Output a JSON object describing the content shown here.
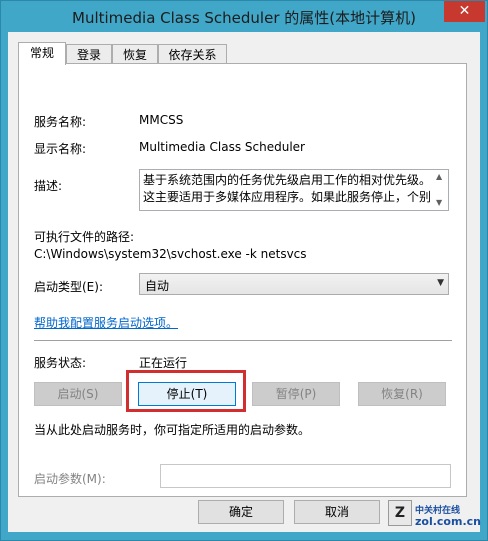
{
  "window": {
    "title": "Multimedia Class Scheduler 的属性(本地计算机)",
    "close_symbol": "✕"
  },
  "tabs": [
    {
      "label": "常规",
      "active": true
    },
    {
      "label": "登录",
      "active": false
    },
    {
      "label": "恢复",
      "active": false
    },
    {
      "label": "依存关系",
      "active": false
    }
  ],
  "general": {
    "service_name_label": "服务名称:",
    "service_name": "MMCSS",
    "display_name_label": "显示名称:",
    "display_name": "Multimedia Class Scheduler",
    "description_label": "描述:",
    "description": "基于系统范围内的任务优先级启用工作的相对优先级。这主要适用于多媒体应用程序。如果此服务停止，个别",
    "exe_path_label": "可执行文件的路径:",
    "exe_path": "C:\\Windows\\system32\\svchost.exe -k netsvcs",
    "startup_type_label": "启动类型(E):",
    "startup_type": "自动",
    "help_link": "帮助我配置服务启动选项。",
    "status_label": "服务状态:",
    "status_value": "正在运行",
    "buttons": {
      "start": "启动(S)",
      "stop": "停止(T)",
      "pause": "暂停(P)",
      "resume": "恢复(R)"
    },
    "hint": "当从此处启动服务时，你可指定所适用的启动参数。",
    "start_params_label": "启动参数(M):",
    "start_params_value": ""
  },
  "footer": {
    "ok": "确定",
    "cancel": "取消"
  },
  "watermark": {
    "logo_letter": "Z",
    "cn_text": "中关村在线",
    "en_text": "zol.com.cn"
  },
  "colors": {
    "title_bar": "#40a7c9",
    "close_button": "#c7392e",
    "highlight": "#d12f2f",
    "link": "#0066cc"
  }
}
